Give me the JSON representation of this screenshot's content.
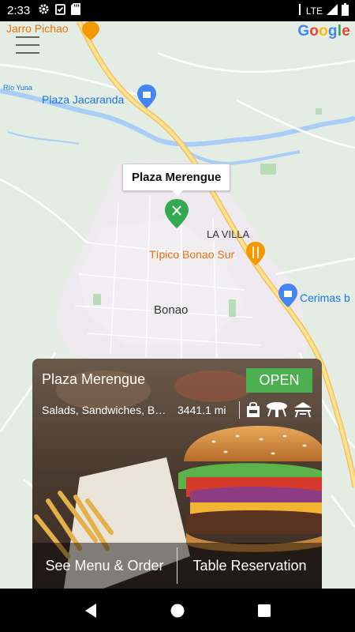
{
  "status_bar": {
    "time": "2:33",
    "network": "LTE",
    "icons": [
      "gear-icon",
      "clipboard-check-icon",
      "sd-card-icon",
      "wifi-icon",
      "signal-icon",
      "battery-icon"
    ]
  },
  "map": {
    "attribution": "Google",
    "labels": {
      "jarro_pichao": "Jarro Pichao",
      "rio_yuna": "Río Yuna",
      "plaza_jacaranda": "Plaza Jacaranda",
      "la_villa": "LA VILLA",
      "tipico_bonao_sur": "Típico Bonao Sur",
      "cerimas": "Cerimas b",
      "bonao": "Bonao"
    },
    "callout_title": "Plaza Merengue"
  },
  "card": {
    "name": "Plaza Merengue",
    "status": "OPEN",
    "categories": "Salads, Sandwiches, Burgers",
    "distance": "3441.1 mi",
    "service_icons": [
      "takeout-bag-icon",
      "dine-in-table-icon",
      "outdoor-seating-icon"
    ],
    "actions": {
      "menu": "See Menu & Order",
      "reservation": "Table Reservation"
    }
  },
  "colors": {
    "open_badge": "#4caf50",
    "marker_green": "#34a853",
    "poi_blue": "#4285f4",
    "poi_orange": "#f29900",
    "road": "#f9d36b"
  }
}
